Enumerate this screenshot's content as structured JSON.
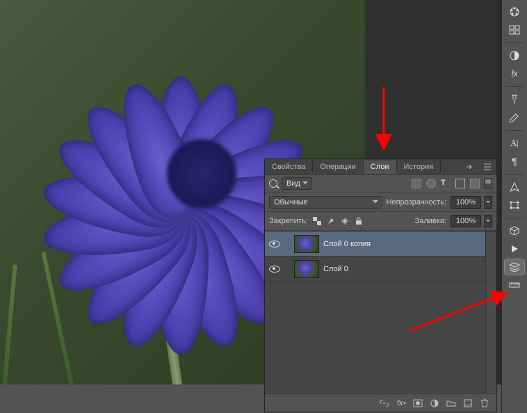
{
  "panel": {
    "tabs": {
      "properties": "Свойства",
      "actions": "Операции",
      "layers": "Слои",
      "history": "История"
    },
    "filter": {
      "kind_label": "Вид"
    },
    "blend": {
      "mode": "Обычные",
      "opacity_label": "Непрозрачность:",
      "opacity_value": "100%"
    },
    "lock": {
      "label": "Закрепить:",
      "fill_label": "Заливка:",
      "fill_value": "100%"
    },
    "layers": [
      {
        "name": "Слой 0 копия"
      },
      {
        "name": "Слой 0"
      }
    ]
  },
  "colors": {
    "panel_bg": "#535353",
    "accent": "#5a6a7e",
    "arrow": "#ff0000"
  }
}
